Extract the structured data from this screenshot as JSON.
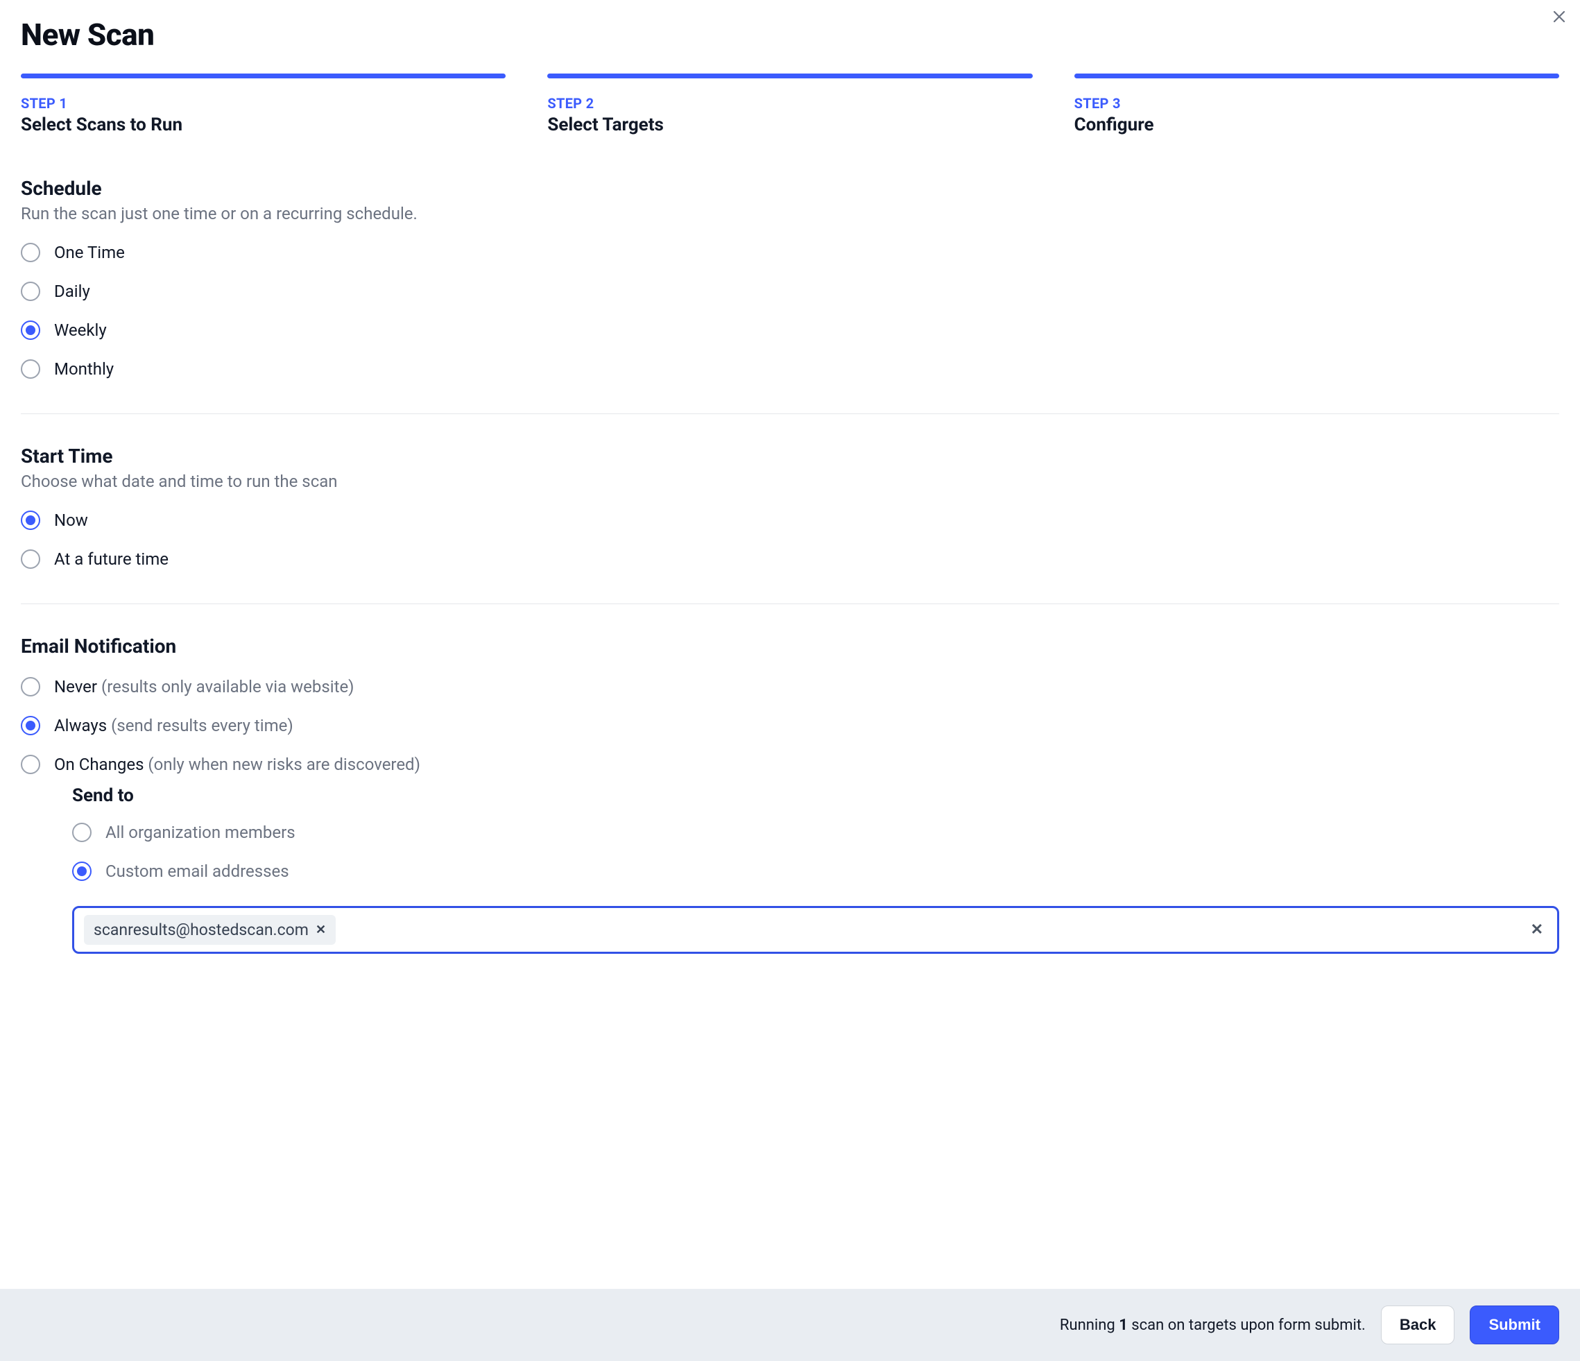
{
  "page_title": "New Scan",
  "steps": [
    {
      "label": "STEP 1",
      "title": "Select Scans to Run"
    },
    {
      "label": "STEP 2",
      "title": "Select Targets"
    },
    {
      "label": "STEP 3",
      "title": "Configure"
    }
  ],
  "schedule": {
    "title": "Schedule",
    "desc": "Run the scan just one time or on a recurring schedule.",
    "options": [
      {
        "label": "One Time",
        "selected": false
      },
      {
        "label": "Daily",
        "selected": false
      },
      {
        "label": "Weekly",
        "selected": true
      },
      {
        "label": "Monthly",
        "selected": false
      }
    ]
  },
  "start_time": {
    "title": "Start Time",
    "desc": "Choose what date and time to run the scan",
    "options": [
      {
        "label": "Now",
        "selected": true
      },
      {
        "label": "At a future time",
        "selected": false
      }
    ]
  },
  "email_notification": {
    "title": "Email Notification",
    "options": [
      {
        "label": "Never",
        "hint": " (results only available via website)",
        "selected": false
      },
      {
        "label": "Always",
        "hint": " (send results every time)",
        "selected": true
      },
      {
        "label": "On Changes",
        "hint": " (only when new risks are discovered)",
        "selected": false
      }
    ],
    "send_to": {
      "title": "Send to",
      "options": [
        {
          "label": "All organization members",
          "selected": false
        },
        {
          "label": "Custom email addresses",
          "selected": true
        }
      ],
      "emails": [
        "scanresults@hostedscan.com"
      ]
    }
  },
  "footer": {
    "running_prefix": "Running ",
    "running_count": "1",
    "running_suffix": " scan on targets upon form submit.",
    "back_label": "Back",
    "submit_label": "Submit"
  }
}
